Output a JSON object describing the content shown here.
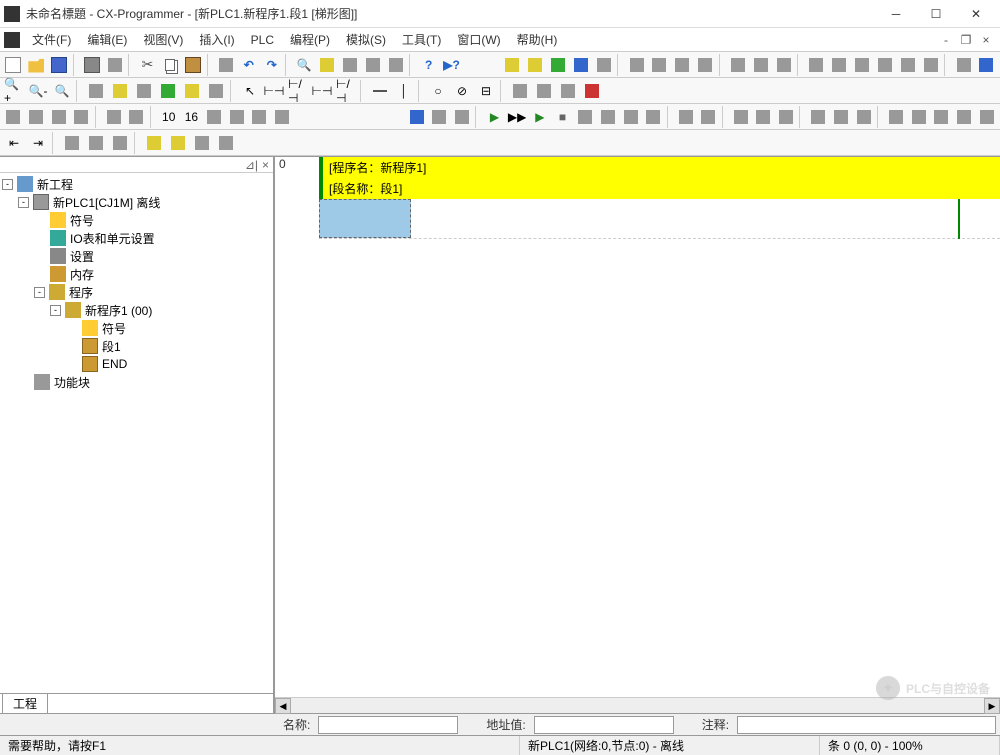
{
  "title": "未命名標題 - CX-Programmer - [新PLC1.新程序1.段1 [梯形图]]",
  "menu": {
    "file": "文件(F)",
    "edit": "编辑(E)",
    "view": "视图(V)",
    "insert": "插入(I)",
    "plc": "PLC",
    "program": "编程(P)",
    "simulate": "模拟(S)",
    "tools": "工具(T)",
    "window": "窗口(W)",
    "help": "帮助(H)"
  },
  "tree": {
    "project": "新工程",
    "plc": "新PLC1[CJ1M] 离线",
    "symbols": "符号",
    "io": "IO表和单元设置",
    "settings": "设置",
    "memory": "内存",
    "programs": "程序",
    "program1": "新程序1 (00)",
    "prog_symbols": "符号",
    "section1": "段1",
    "end": "END",
    "fb": "功能块"
  },
  "panel_tab": "工程",
  "ladder": {
    "rung_num": "0",
    "program_name_label": "[程序名：新程序1]",
    "section_name_label": "[段名称：段1]"
  },
  "fields": {
    "name_label": "名称:",
    "address_label": "地址值:",
    "comment_label": "注释:"
  },
  "status": {
    "help": "需要帮助，请按F1",
    "connection": "新PLC1(网络:0,节点:0) - 离线",
    "position": "条 0 (0, 0) - 100%"
  },
  "watermark": "PLC与自控设备"
}
